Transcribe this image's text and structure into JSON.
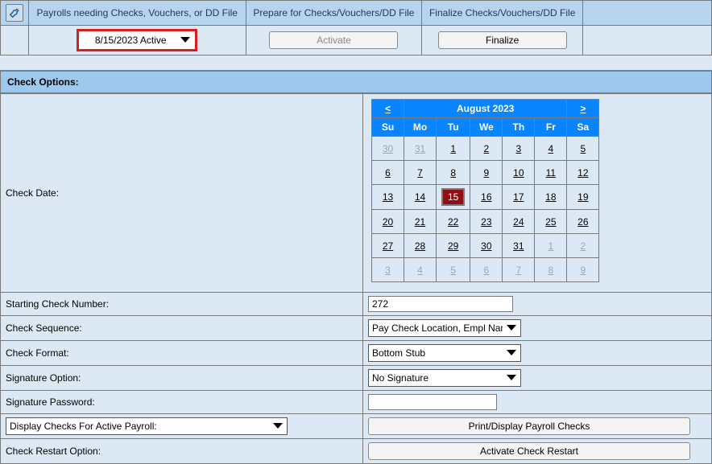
{
  "header_tabs": {
    "col1": "Payrolls needing Checks, Vouchers, or DD File",
    "col2": "Prepare for Checks/Vouchers/DD File",
    "col3": "Finalize Checks/Vouchers/DD File"
  },
  "payroll_dropdown_value": "8/15/2023 Active",
  "activate_btn": "Activate",
  "finalize_btn": "Finalize",
  "section_title": "Check Options:",
  "calendar": {
    "title": "August 2023",
    "prev": "<",
    "next": ">",
    "dow": [
      "Su",
      "Mo",
      "Tu",
      "We",
      "Th",
      "Fr",
      "Sa"
    ],
    "weeks": [
      [
        {
          "d": "30",
          "other": true
        },
        {
          "d": "31",
          "other": true
        },
        {
          "d": "1"
        },
        {
          "d": "2"
        },
        {
          "d": "3"
        },
        {
          "d": "4"
        },
        {
          "d": "5"
        }
      ],
      [
        {
          "d": "6"
        },
        {
          "d": "7"
        },
        {
          "d": "8"
        },
        {
          "d": "9"
        },
        {
          "d": "10"
        },
        {
          "d": "11"
        },
        {
          "d": "12"
        }
      ],
      [
        {
          "d": "13"
        },
        {
          "d": "14"
        },
        {
          "d": "15",
          "sel": true
        },
        {
          "d": "16"
        },
        {
          "d": "17"
        },
        {
          "d": "18"
        },
        {
          "d": "19"
        }
      ],
      [
        {
          "d": "20"
        },
        {
          "d": "21"
        },
        {
          "d": "22"
        },
        {
          "d": "23"
        },
        {
          "d": "24"
        },
        {
          "d": "25"
        },
        {
          "d": "26"
        }
      ],
      [
        {
          "d": "27"
        },
        {
          "d": "28"
        },
        {
          "d": "29"
        },
        {
          "d": "30"
        },
        {
          "d": "31"
        },
        {
          "d": "1",
          "other": true
        },
        {
          "d": "2",
          "other": true
        }
      ],
      [
        {
          "d": "3",
          "other": true
        },
        {
          "d": "4",
          "other": true
        },
        {
          "d": "5",
          "other": true
        },
        {
          "d": "6",
          "other": true
        },
        {
          "d": "7",
          "other": true
        },
        {
          "d": "8",
          "other": true
        },
        {
          "d": "9",
          "other": true
        }
      ]
    ]
  },
  "labels": {
    "check_date": "Check Date:",
    "starting_check_number": "Starting Check Number:",
    "check_sequence": "Check Sequence:",
    "check_format": "Check Format:",
    "signature_option": "Signature Option:",
    "signature_password": "Signature Password:",
    "check_restart": "Check Restart Option:"
  },
  "values": {
    "starting_check_number": "272",
    "check_sequence": "Pay Check Location, Empl Name",
    "check_format": "Bottom Stub",
    "signature_option": "No Signature",
    "signature_password": "",
    "display_checks_select": "Display Checks For Active Payroll:"
  },
  "buttons": {
    "print_display": "Print/Display Payroll Checks",
    "activate_restart": "Activate Check Restart"
  }
}
